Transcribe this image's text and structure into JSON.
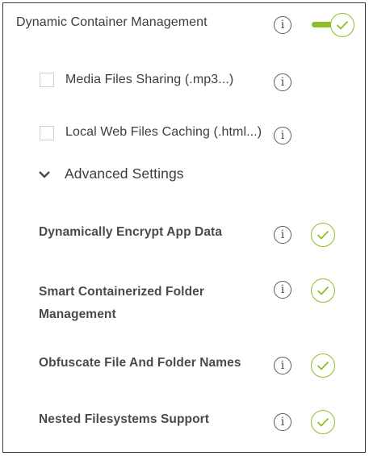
{
  "dynamic_container": {
    "label": "Dynamic Container Management",
    "enabled": true
  },
  "options": [
    {
      "label": "Media Files Sharing (.mp3...)",
      "checked": false
    },
    {
      "label": "Local Web Files Caching (.html...)",
      "checked": false
    }
  ],
  "advanced": {
    "label": "Advanced Settings",
    "expanded": true,
    "items": [
      {
        "line1": "Dynamically Encrypt App Data",
        "line2": "",
        "enabled": true
      },
      {
        "line1": "Smart Containerized Folder",
        "line2": "Management",
        "enabled": true
      },
      {
        "line1": "Obfuscate File And Folder Names",
        "line2": "",
        "enabled": true
      },
      {
        "line1": "Nested Filesystems Support",
        "line2": "",
        "enabled": true
      }
    ]
  },
  "icons": {
    "info": "info-icon",
    "check": "check-icon",
    "chevron": "chevron-down-icon"
  },
  "colors": {
    "accent": "#8cbe28",
    "border": "#3c3c3c",
    "text": "#3d3d3d"
  }
}
